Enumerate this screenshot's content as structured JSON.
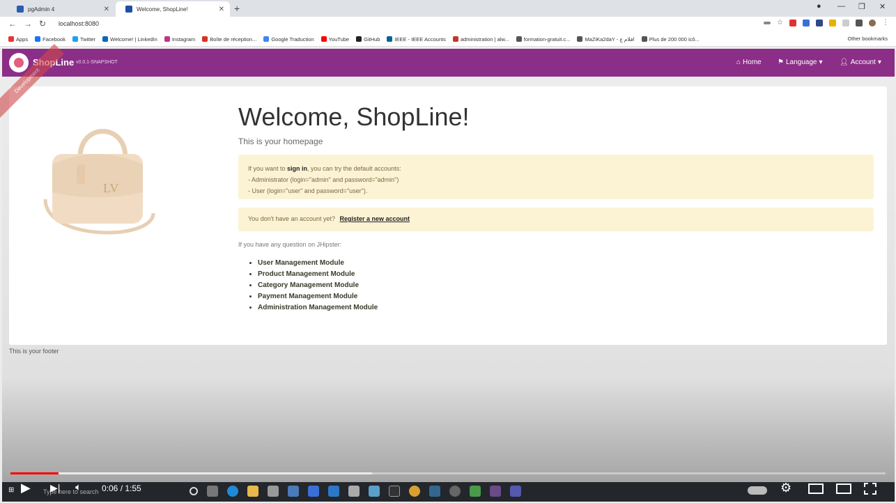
{
  "browser": {
    "tabs": [
      {
        "label": "pgAdmin 4",
        "favicon_color": "#2a5db0"
      },
      {
        "label": "Welcome, ShopLine!",
        "favicon_color": "#1e4fa8"
      }
    ],
    "url": "localhost:8080",
    "bookmarks": [
      {
        "label": "Apps",
        "color": "#e33"
      },
      {
        "label": "Facebook",
        "color": "#1877f2"
      },
      {
        "label": "Twitter",
        "color": "#1da1f2"
      },
      {
        "label": "Welcome! | LinkedIn",
        "color": "#0a66c2"
      },
      {
        "label": "Instagram",
        "color": "#c13584"
      },
      {
        "label": "Boîte de réception...",
        "color": "#d93025"
      },
      {
        "label": "Google Traduction",
        "color": "#4285f4"
      },
      {
        "label": "YouTube",
        "color": "#f00"
      },
      {
        "label": "GitHub",
        "color": "#222"
      },
      {
        "label": "IEEE - IEEE Accounts",
        "color": "#00629b"
      },
      {
        "label": "administration | alw...",
        "color": "#c0392b"
      },
      {
        "label": "formation-gratuit.c...",
        "color": "#555"
      },
      {
        "label": "MaZiKa2daY - افلام ع",
        "color": "#555"
      },
      {
        "label": "Plus de 200 000 icô...",
        "color": "#555"
      }
    ],
    "other_bookmarks": "Other bookmarks"
  },
  "app": {
    "brand": "ShopLine",
    "version": "v0.0.1-SNAPSHOT",
    "ribbon": "Development",
    "nav": {
      "home": "Home",
      "language": "Language",
      "account": "Account"
    },
    "colors": {
      "navbar": "#8b2e87",
      "alert": "#fcf3d5"
    }
  },
  "main": {
    "title": "Welcome, ShopLine!",
    "lead": "This is your homepage",
    "signin_alert": {
      "prefix": "If you want to",
      "signin": "sign in",
      "suffix": ", you can try the default accounts:",
      "line_admin": "- Administrator (login=\"admin\" and password=\"admin\")",
      "line_user": "- User (login=\"user\" and password=\"user\")."
    },
    "register_alert": {
      "text": "You don't have an account yet?",
      "link": "Register a new account"
    },
    "question": "If you have any question on JHipster:",
    "modules": [
      "User Management Module",
      "Product Management Module",
      "Category Management Module",
      "Payment Management Module",
      "Administration Management Module"
    ],
    "footer": "This is your footer"
  },
  "player": {
    "timecode": "0:06 / 1:55",
    "played_fraction": 0.055,
    "loaded_fraction": 0.413,
    "search_placeholder": "Type here to search"
  }
}
